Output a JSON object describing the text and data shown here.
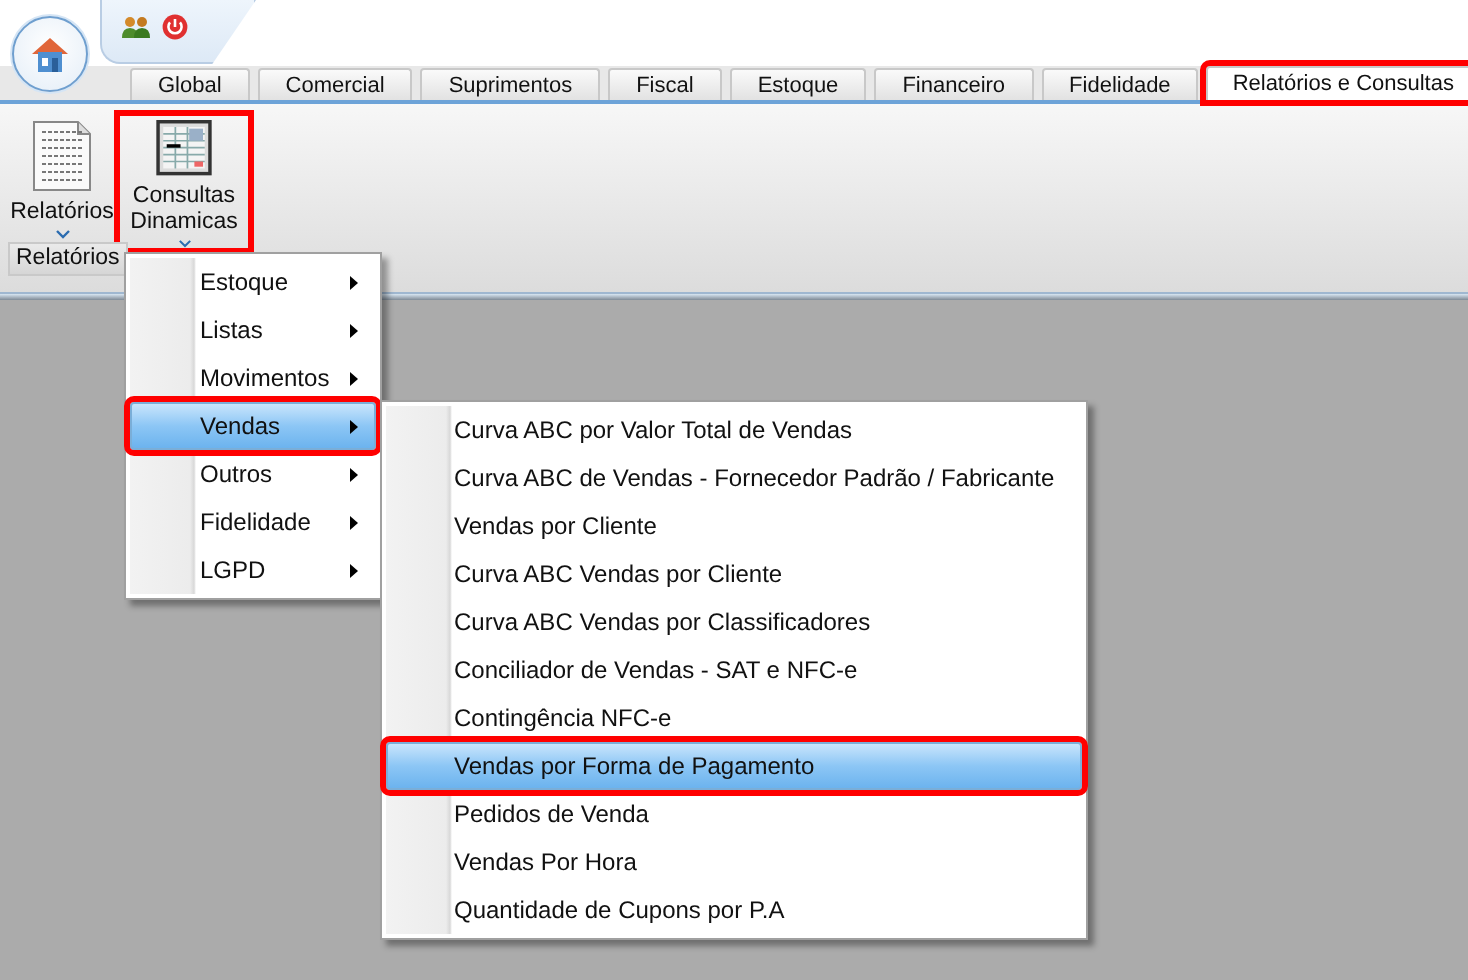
{
  "tabs": [
    {
      "label": "Global",
      "selected": false,
      "highlighted": false
    },
    {
      "label": "Comercial",
      "selected": false,
      "highlighted": false
    },
    {
      "label": "Suprimentos",
      "selected": false,
      "highlighted": false
    },
    {
      "label": "Fiscal",
      "selected": false,
      "highlighted": false
    },
    {
      "label": "Estoque",
      "selected": false,
      "highlighted": false
    },
    {
      "label": "Financeiro",
      "selected": false,
      "highlighted": false
    },
    {
      "label": "Fidelidade",
      "selected": false,
      "highlighted": false
    },
    {
      "label": "Relatórios e Consultas",
      "selected": true,
      "highlighted": true
    }
  ],
  "ribbon": {
    "buttons": [
      {
        "kind": "report",
        "label": "Relatórios",
        "highlighted": false
      },
      {
        "kind": "query",
        "label": "Consultas Dinamicas",
        "highlighted": true
      }
    ],
    "group_label": "Relatórios"
  },
  "menu": {
    "items": [
      {
        "label": "Estoque",
        "has_submenu": true,
        "selected": false,
        "highlighted": false
      },
      {
        "label": "Listas",
        "has_submenu": true,
        "selected": false,
        "highlighted": false
      },
      {
        "label": "Movimentos",
        "has_submenu": true,
        "selected": false,
        "highlighted": false
      },
      {
        "label": "Vendas",
        "has_submenu": true,
        "selected": true,
        "highlighted": true
      },
      {
        "label": "Outros",
        "has_submenu": true,
        "selected": false,
        "highlighted": false
      },
      {
        "label": "Fidelidade",
        "has_submenu": true,
        "selected": false,
        "highlighted": false
      },
      {
        "label": "LGPD",
        "has_submenu": true,
        "selected": false,
        "highlighted": false
      }
    ]
  },
  "submenu": {
    "items": [
      {
        "label": "Curva ABC por Valor Total de Vendas",
        "selected": false,
        "highlighted": false
      },
      {
        "label": "Curva ABC de Vendas - Fornecedor Padrão / Fabricante",
        "selected": false,
        "highlighted": false
      },
      {
        "label": "Vendas por Cliente",
        "selected": false,
        "highlighted": false
      },
      {
        "label": "Curva ABC Vendas por Cliente",
        "selected": false,
        "highlighted": false
      },
      {
        "label": "Curva ABC Vendas por Classificadores",
        "selected": false,
        "highlighted": false
      },
      {
        "label": "Conciliador de Vendas - SAT e NFC-e",
        "selected": false,
        "highlighted": false
      },
      {
        "label": "Contingência NFC-e",
        "selected": false,
        "highlighted": false
      },
      {
        "label": "Vendas por Forma de Pagamento",
        "selected": true,
        "highlighted": true
      },
      {
        "label": "Pedidos de Venda",
        "selected": false,
        "highlighted": false
      },
      {
        "label": "Vendas Por Hora",
        "selected": false,
        "highlighted": false
      },
      {
        "label": "Quantidade de Cupons por P.A",
        "selected": false,
        "highlighted": false
      }
    ]
  }
}
